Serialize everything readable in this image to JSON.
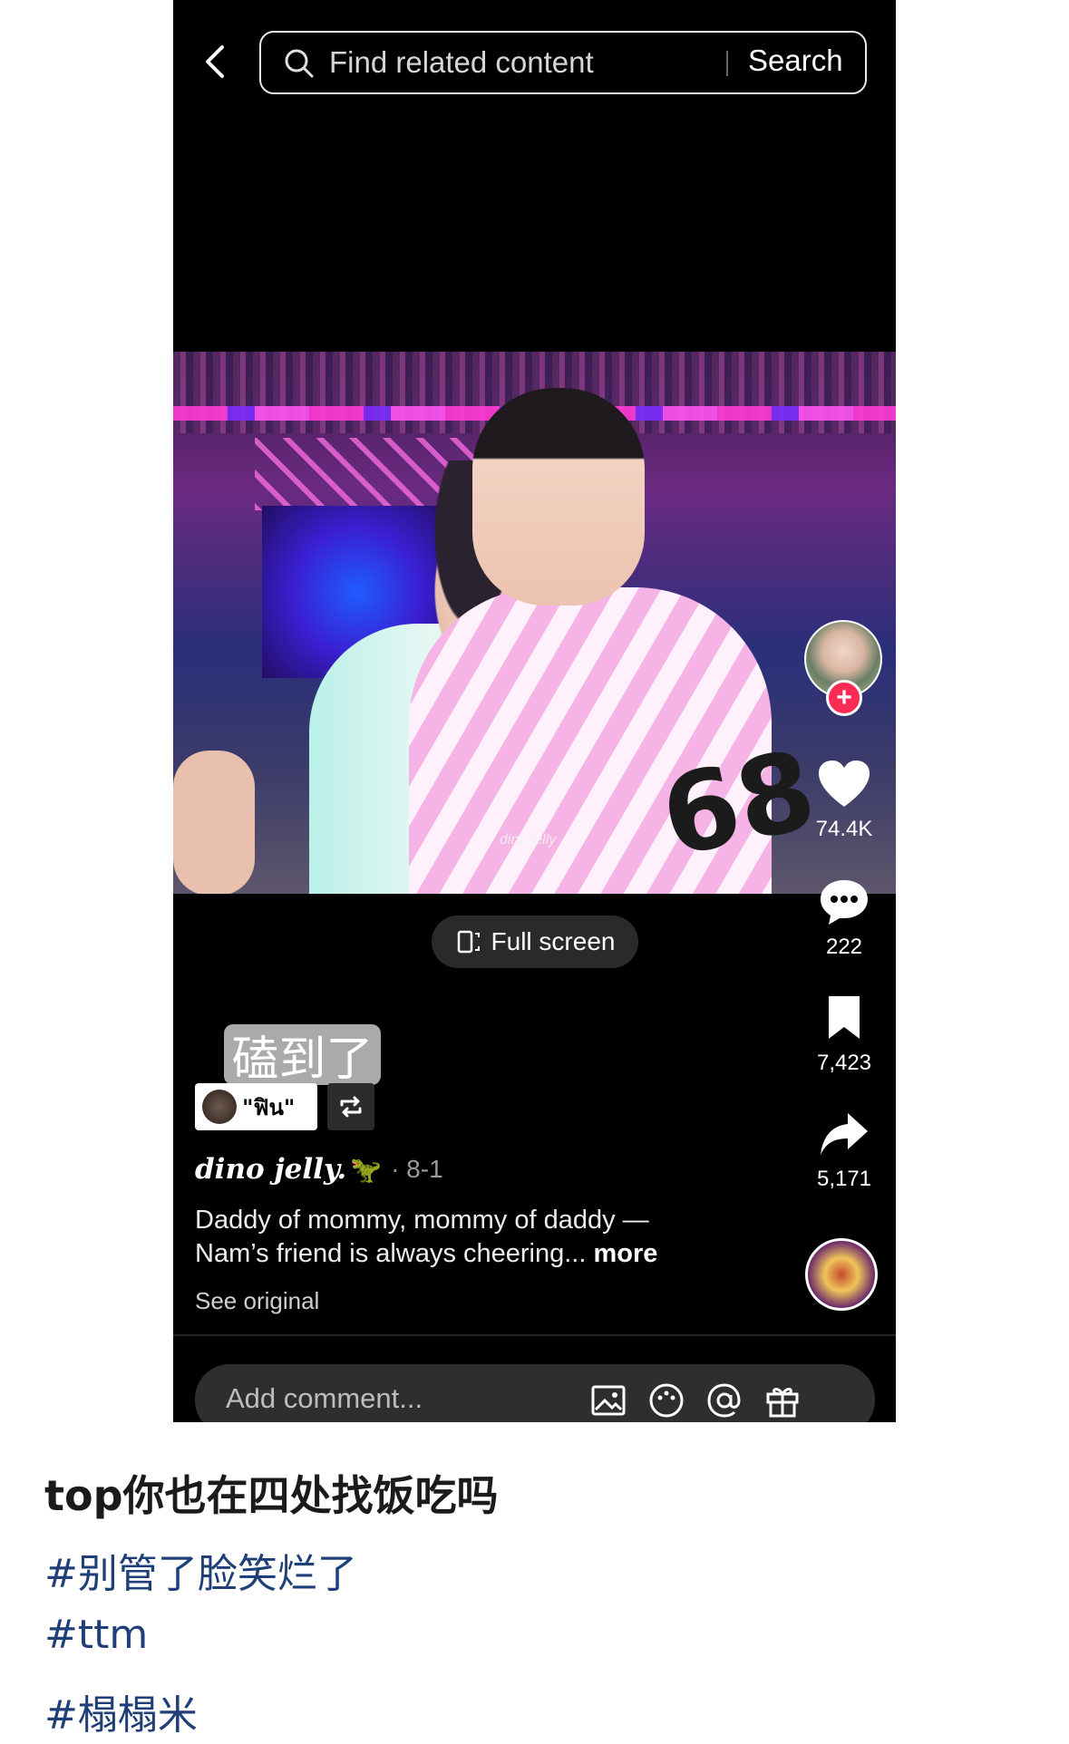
{
  "topbar": {
    "search_placeholder": "Find related content",
    "search_button": "Search"
  },
  "video": {
    "watermark": "dino jelly",
    "jersey_number": "68"
  },
  "fullscreen": {
    "label": "Full screen"
  },
  "sidebar": {
    "likes": "74.4K",
    "comments": "222",
    "saves": "7,423",
    "shares": "5,171"
  },
  "overlay": {
    "sticker_text": "磕到了",
    "sound_label": "\"ฟิน\""
  },
  "post": {
    "username": "dino jelly.",
    "date": "· 8-1",
    "description_line1": "Daddy of mommy, mommy of daddy —",
    "description_line2": "Nam’s friend is always cheering...",
    "more": "more",
    "see_original": "See original"
  },
  "comment_bar": {
    "placeholder": "Add comment..."
  },
  "feed": {
    "post_text": "top你也在四处找饭吃吗",
    "hashtags": [
      "#别管了脸笑烂了",
      "#ttm",
      "#榻榻米"
    ]
  },
  "colors": {
    "accent": "#fe2c55",
    "hashtag": "#1f3f78"
  },
  "icons": [
    "back-icon",
    "search-icon",
    "fullscreen-icon",
    "heart-icon",
    "comment-icon",
    "bookmark-icon",
    "share-icon",
    "repost-icon",
    "image-icon",
    "emoji-icon",
    "mention-icon",
    "gift-icon"
  ]
}
